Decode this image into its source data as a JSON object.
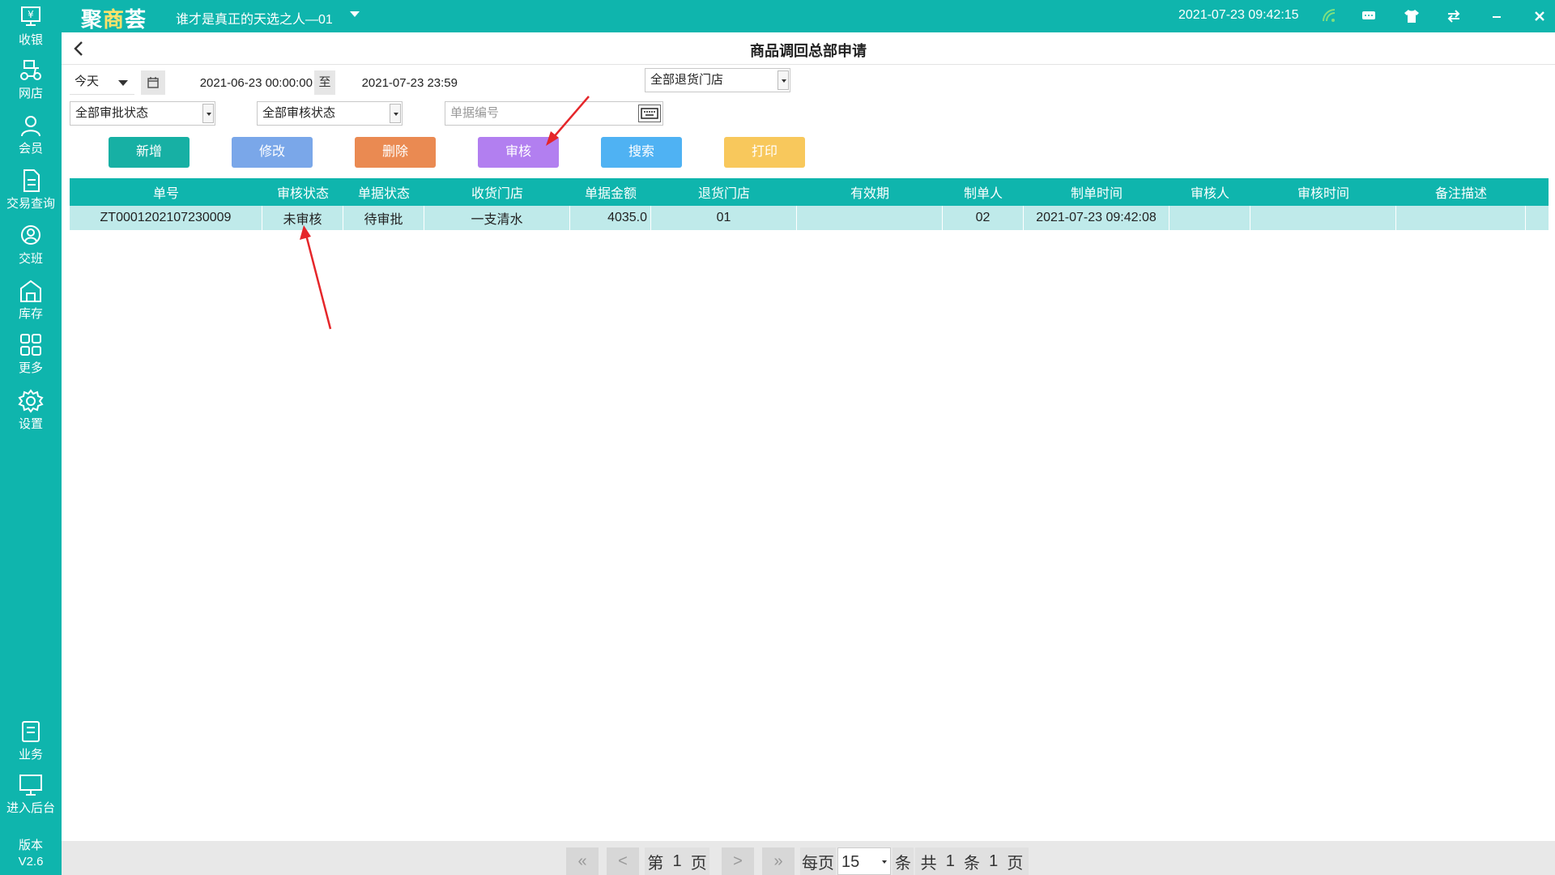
{
  "app": {
    "logo_main": "聚",
    "logo_accent": "商",
    "logo_tail": "荟",
    "store_name": "谁才是真正的天选之人—01",
    "clock": "2021-07-23 09:42:15",
    "version_label": "版本",
    "version_value": "V2.6",
    "brand_color": "#0fb5ad"
  },
  "sidebar": {
    "items": [
      {
        "label": "收银",
        "icon": "cashier-icon"
      },
      {
        "label": "网店",
        "icon": "scooter-icon"
      },
      {
        "label": "会员",
        "icon": "user-icon"
      },
      {
        "label": "交易查询",
        "icon": "document-icon"
      },
      {
        "label": "交班",
        "icon": "handover-icon"
      },
      {
        "label": "库存",
        "icon": "warehouse-icon"
      },
      {
        "label": "更多",
        "icon": "grid-icon"
      },
      {
        "label": "设置",
        "icon": "gear-icon"
      },
      {
        "label": "业务",
        "icon": "book-icon"
      },
      {
        "label": "进入后台",
        "icon": "monitor-icon"
      }
    ]
  },
  "page": {
    "title": "商品调回总部申请"
  },
  "filters": {
    "quick_date": "今天",
    "start_date": "2021-06-23 00:00:00",
    "to_label": "至",
    "end_date": "2021-07-23 23:59",
    "return_store": "全部退货门店",
    "approve_status": "全部审批状态",
    "review_status": "全部审核状态",
    "doc_no_placeholder": "单据编号"
  },
  "actions": {
    "add": "新增",
    "edit": "修改",
    "delete": "删除",
    "review": "审核",
    "search": "搜索",
    "print": "打印",
    "colors": {
      "add": "#17b0a4",
      "edit": "#7aa7e9",
      "delete": "#ea8a52",
      "review": "#b27ff0",
      "search": "#4fb2f3",
      "print": "#f8c85c"
    }
  },
  "table": {
    "headers": [
      "单号",
      "审核状态",
      "单据状态",
      "收货门店",
      "单据金额",
      "退货门店",
      "有效期",
      "制单人",
      "制单时间",
      "审核人",
      "审核时间",
      "备注描述"
    ],
    "rows": [
      [
        "ZT0001202107230009",
        "未审核",
        "待审批",
        "一支清水",
        "4035.0",
        "01",
        "",
        "02",
        "2021-07-23 09:42:08",
        "",
        "",
        ""
      ]
    ]
  },
  "pager": {
    "first": "«",
    "prev": "<",
    "page_prefix": "第",
    "current_page": "1",
    "page_suffix": "页",
    "next": ">",
    "last": "»",
    "per_page_label": "每页",
    "per_page": "15",
    "per_page_unit": "条",
    "total_prefix": "共",
    "total_count": "1",
    "total_unit": "条",
    "total_pages": "1",
    "pages_unit": "页"
  },
  "annotations": {
    "arrow_color": "#e5262a"
  }
}
